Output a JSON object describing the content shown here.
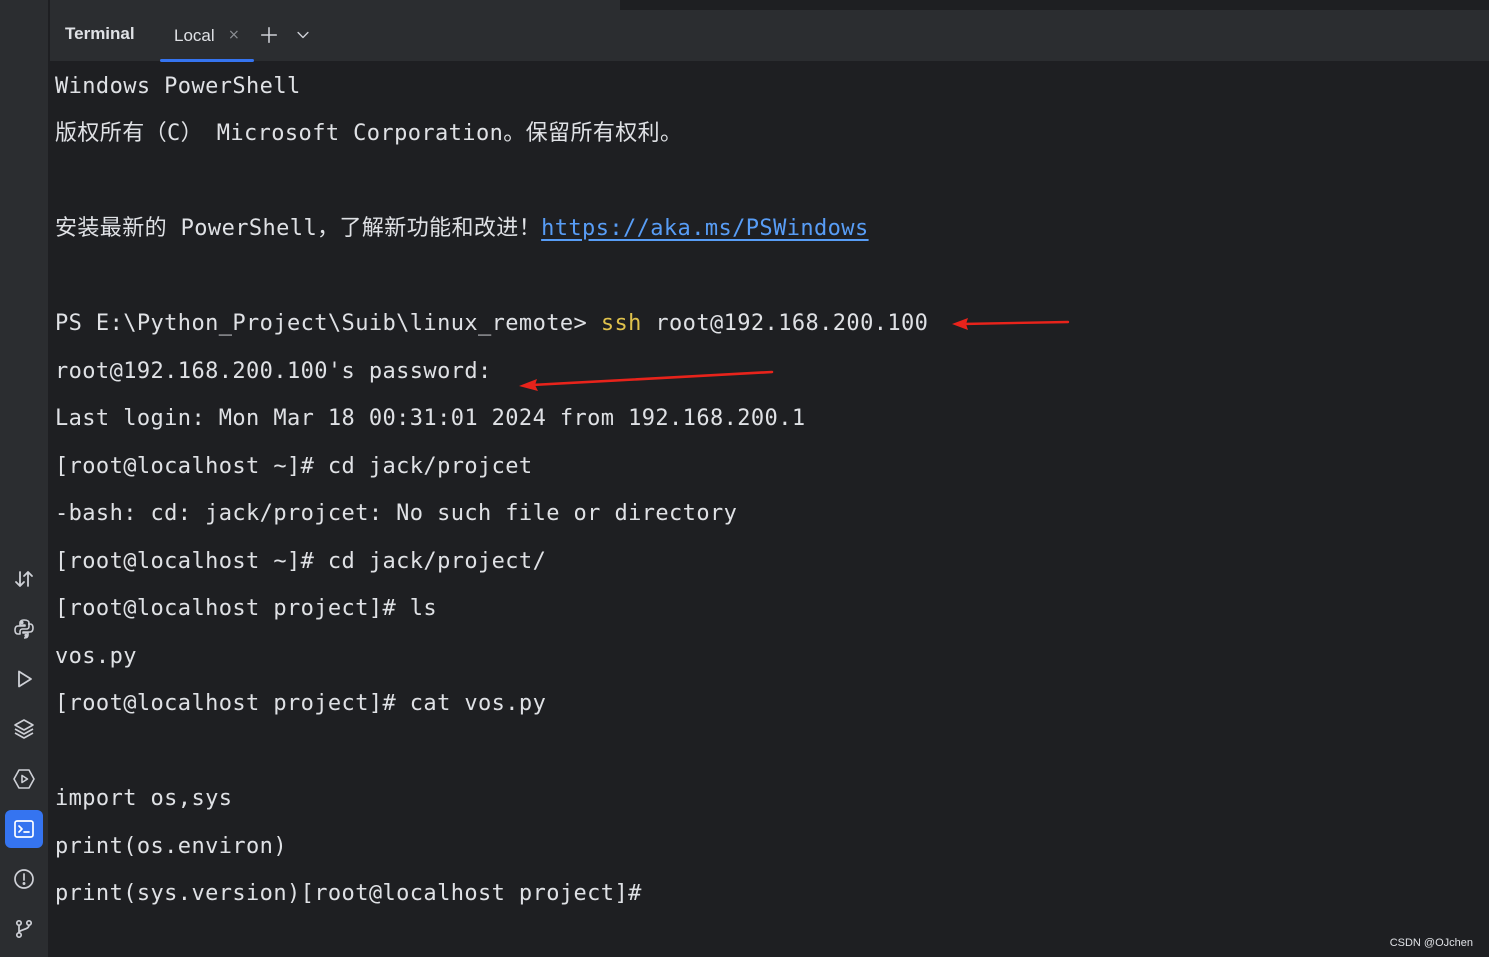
{
  "header": {
    "title": "Terminal",
    "tab_label": "Local",
    "tab_close_glyph": "×"
  },
  "sidebar": {
    "icons": [
      "sort-arrows-icon",
      "python-icon",
      "run-icon",
      "layers-icon",
      "services-icon",
      "terminal-icon",
      "problems-icon",
      "git-branch-icon"
    ],
    "active": "terminal-icon"
  },
  "terminal": {
    "line1": "Windows PowerShell",
    "line2": "版权所有（C） Microsoft Corporation。保留所有权利。",
    "line3_text": "安装最新的 PowerShell，了解新功能和改进！",
    "line3_link": "https://aka.ms/PSWindows",
    "prompt_path": "PS E:\\Python_Project\\Suib\\linux_remote> ",
    "prompt_cmd": "ssh",
    "prompt_args": " root@192.168.200.100",
    "password_prompt": "root@192.168.200.100's password:",
    "last_login": "Last login: Mon Mar 18 00:31:01 2024 from 192.168.200.1",
    "cmd1": "[root@localhost ~]# cd jack/projcet",
    "error1": "-bash: cd: jack/projcet: No such file or directory",
    "cmd2": "[root@localhost ~]# cd jack/project/",
    "cmd3": "[root@localhost project]# ls",
    "ls_output": "vos.py",
    "cmd4": "[root@localhost project]# cat vos.py",
    "code1": "import os,sys",
    "code2": "print(os.environ)",
    "code3": "print(sys.version)[root@localhost project]#"
  },
  "annotations": {
    "arrow_color": "#e8231b"
  },
  "watermark": "CSDN @OJchen",
  "colors": {
    "background": "#1e1f22",
    "panel": "#2b2d30",
    "text": "#dfe1e5",
    "command": "#e0c24c",
    "link": "#589df6",
    "accent": "#3574f0"
  }
}
